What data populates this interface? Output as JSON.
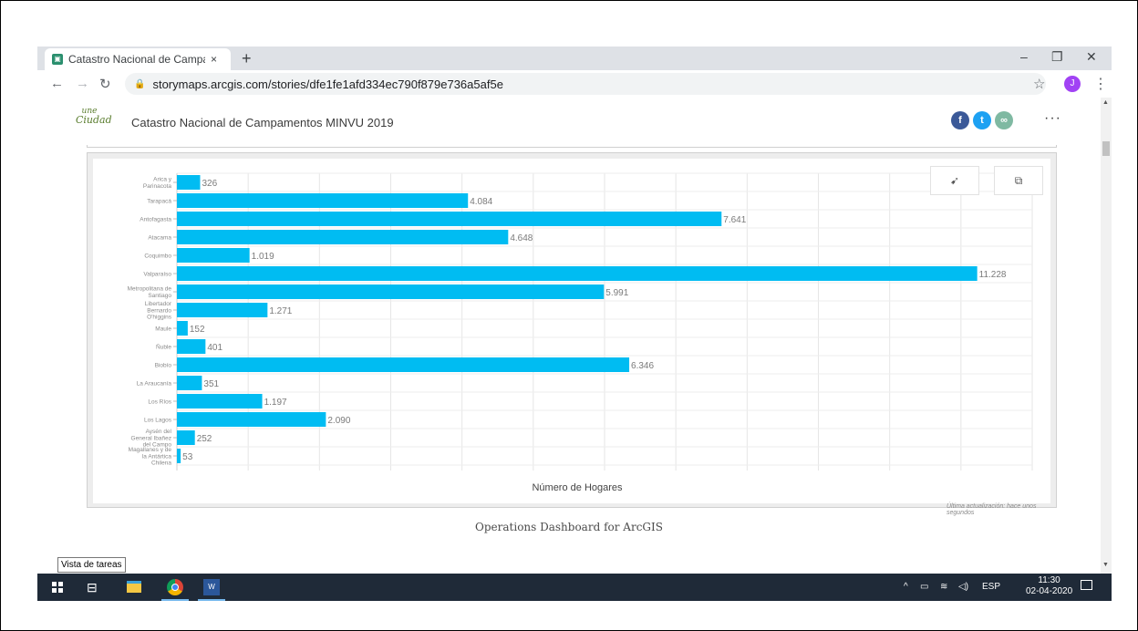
{
  "browser": {
    "tab_title": "Catastro Nacional de Campamen",
    "tab_close": "×",
    "new_tab": "+",
    "url": "storymaps.arcgis.com/stories/dfe1fe1afd334ec790f879e736a5af5e",
    "profile_initial": "J",
    "window_minimize": "–",
    "window_restore": "❐",
    "window_close": "✕"
  },
  "story": {
    "logo_text": "une Ciudad",
    "title": "Catastro Nacional de Campamentos MINVU 2019",
    "more": "···"
  },
  "dashboard": {
    "updated_text": "Última actualización: hace unos segundos",
    "caption": "Operations Dashboard for ArcGIS"
  },
  "tooltip": {
    "text": "Vista de tareas"
  },
  "taskbar": {
    "language": "ESP",
    "time": "11:30",
    "date": "02-04-2020"
  },
  "colors": {
    "bar": "#00bcf2",
    "taskbar": "#1f2a38",
    "facebook": "#3b5998",
    "twitter": "#1da1f2",
    "link": "#7fb9a2"
  },
  "chart_data": {
    "type": "bar",
    "orientation": "horizontal",
    "categories": [
      "Arica y Parinacota",
      "Tarapacá",
      "Antofagasta",
      "Atacama",
      "Coquimbo",
      "Valparaíso",
      "Metropolitana de Santiago",
      "Libertador Bernardo O'higgins",
      "Maule",
      "Ñuble",
      "Biobío",
      "La Araucanía",
      "Los Ríos",
      "Los Lagos",
      "Aysén del General Ibañez del Campo",
      "Magallanes y de la Antártica Chilena"
    ],
    "values": [
      326,
      4084,
      7641,
      4648,
      1019,
      11228,
      5991,
      1271,
      152,
      401,
      6346,
      351,
      1197,
      2090,
      252,
      53
    ],
    "value_labels": [
      "326",
      "4.084",
      "7.641",
      "4.648",
      "1.019",
      "11.228",
      "5.991",
      "1.271",
      "152",
      "401",
      "6.346",
      "351",
      "1.197",
      "2.090",
      "252",
      "53"
    ],
    "xlabel": "Número de Hogares",
    "ylabel": "",
    "xlim": [
      0,
      12000
    ],
    "grid": true
  }
}
